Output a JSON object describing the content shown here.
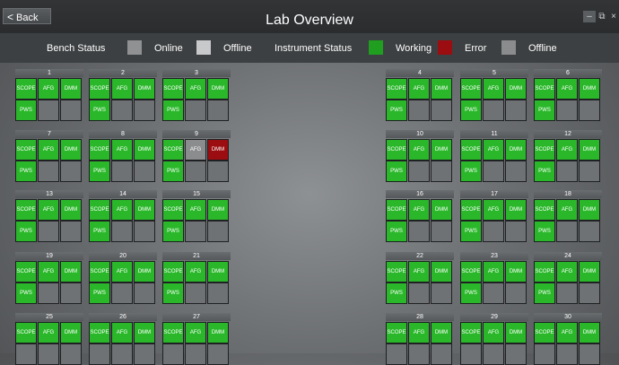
{
  "window": {
    "title": "Lab Overview",
    "back_label": "Back",
    "minimize": "–",
    "maximize": "⧉",
    "close": "×"
  },
  "legend": {
    "bench_status_label": "Bench Status",
    "online_label": "Online",
    "offline_label": "Offline",
    "instrument_status_label": "Instrument Status",
    "working_label": "Working",
    "error_label": "Error",
    "instrument_offline_label": "Offline",
    "colors": {
      "online": "#8f9193",
      "offline": "#c8c9ca",
      "working": "#1f9e1f",
      "error": "#9b0d10",
      "instrument_offline": "#8a8c8e"
    }
  },
  "benches": [
    {
      "number": "1",
      "instruments": [
        {
          "label": "SCOPE",
          "status": "working"
        },
        {
          "label": "AFG",
          "status": "working"
        },
        {
          "label": "DMM",
          "status": "working"
        },
        {
          "label": "PWS",
          "status": "working"
        },
        {
          "label": "",
          "status": "empty"
        },
        {
          "label": "",
          "status": "empty"
        }
      ]
    },
    {
      "number": "2",
      "instruments": [
        {
          "label": "SCOPE",
          "status": "working"
        },
        {
          "label": "AFG",
          "status": "working"
        },
        {
          "label": "DMM",
          "status": "working"
        },
        {
          "label": "PWS",
          "status": "working"
        },
        {
          "label": "",
          "status": "empty"
        },
        {
          "label": "",
          "status": "empty"
        }
      ]
    },
    {
      "number": "3",
      "instruments": [
        {
          "label": "SCOPE",
          "status": "working"
        },
        {
          "label": "AFG",
          "status": "working"
        },
        {
          "label": "DMM",
          "status": "working"
        },
        {
          "label": "PWS",
          "status": "working"
        },
        {
          "label": "",
          "status": "empty"
        },
        {
          "label": "",
          "status": "empty"
        }
      ]
    },
    {
      "number": "4",
      "instruments": [
        {
          "label": "SCOPE",
          "status": "working"
        },
        {
          "label": "AFG",
          "status": "working"
        },
        {
          "label": "DMM",
          "status": "working"
        },
        {
          "label": "PWS",
          "status": "working"
        },
        {
          "label": "",
          "status": "empty"
        },
        {
          "label": "",
          "status": "empty"
        }
      ]
    },
    {
      "number": "5",
      "instruments": [
        {
          "label": "SCOPE",
          "status": "working"
        },
        {
          "label": "AFG",
          "status": "working"
        },
        {
          "label": "DMM",
          "status": "working"
        },
        {
          "label": "PWS",
          "status": "working"
        },
        {
          "label": "",
          "status": "empty"
        },
        {
          "label": "",
          "status": "empty"
        }
      ]
    },
    {
      "number": "6",
      "instruments": [
        {
          "label": "SCOPE",
          "status": "working"
        },
        {
          "label": "AFG",
          "status": "working"
        },
        {
          "label": "DMM",
          "status": "working"
        },
        {
          "label": "PWS",
          "status": "working"
        },
        {
          "label": "",
          "status": "empty"
        },
        {
          "label": "",
          "status": "empty"
        }
      ]
    },
    {
      "number": "7",
      "instruments": [
        {
          "label": "SCOPE",
          "status": "working"
        },
        {
          "label": "AFG",
          "status": "working"
        },
        {
          "label": "DMM",
          "status": "working"
        },
        {
          "label": "PWS",
          "status": "working"
        },
        {
          "label": "",
          "status": "empty"
        },
        {
          "label": "",
          "status": "empty"
        }
      ]
    },
    {
      "number": "8",
      "instruments": [
        {
          "label": "SCOPE",
          "status": "working"
        },
        {
          "label": "AFG",
          "status": "working"
        },
        {
          "label": "DMM",
          "status": "working"
        },
        {
          "label": "PWS",
          "status": "working"
        },
        {
          "label": "",
          "status": "empty"
        },
        {
          "label": "",
          "status": "empty"
        }
      ]
    },
    {
      "number": "9",
      "instruments": [
        {
          "label": "SCOPE",
          "status": "working"
        },
        {
          "label": "AFG",
          "status": "offline"
        },
        {
          "label": "DMM",
          "status": "error"
        },
        {
          "label": "PWS",
          "status": "working"
        },
        {
          "label": "",
          "status": "empty"
        },
        {
          "label": "",
          "status": "empty"
        }
      ]
    },
    {
      "number": "10",
      "instruments": [
        {
          "label": "SCOPE",
          "status": "working"
        },
        {
          "label": "AFG",
          "status": "working"
        },
        {
          "label": "DMM",
          "status": "working"
        },
        {
          "label": "PWS",
          "status": "working"
        },
        {
          "label": "",
          "status": "empty"
        },
        {
          "label": "",
          "status": "empty"
        }
      ]
    },
    {
      "number": "11",
      "instruments": [
        {
          "label": "SCOPE",
          "status": "working"
        },
        {
          "label": "AFG",
          "status": "working"
        },
        {
          "label": "DMM",
          "status": "working"
        },
        {
          "label": "PWS",
          "status": "working"
        },
        {
          "label": "",
          "status": "empty"
        },
        {
          "label": "",
          "status": "empty"
        }
      ]
    },
    {
      "number": "12",
      "instruments": [
        {
          "label": "SCOPE",
          "status": "working"
        },
        {
          "label": "AFG",
          "status": "working"
        },
        {
          "label": "DMM",
          "status": "working"
        },
        {
          "label": "PWS",
          "status": "working"
        },
        {
          "label": "",
          "status": "empty"
        },
        {
          "label": "",
          "status": "empty"
        }
      ]
    },
    {
      "number": "13",
      "instruments": [
        {
          "label": "SCOPE",
          "status": "working"
        },
        {
          "label": "AFG",
          "status": "working"
        },
        {
          "label": "DMM",
          "status": "working"
        },
        {
          "label": "PWS",
          "status": "working"
        },
        {
          "label": "",
          "status": "empty"
        },
        {
          "label": "",
          "status": "empty"
        }
      ]
    },
    {
      "number": "14",
      "instruments": [
        {
          "label": "SCOPE",
          "status": "working"
        },
        {
          "label": "AFG",
          "status": "working"
        },
        {
          "label": "DMM",
          "status": "working"
        },
        {
          "label": "PWS",
          "status": "working"
        },
        {
          "label": "",
          "status": "empty"
        },
        {
          "label": "",
          "status": "empty"
        }
      ]
    },
    {
      "number": "15",
      "instruments": [
        {
          "label": "SCOPE",
          "status": "working"
        },
        {
          "label": "AFG",
          "status": "working"
        },
        {
          "label": "DMM",
          "status": "working"
        },
        {
          "label": "PWS",
          "status": "working"
        },
        {
          "label": "",
          "status": "empty"
        },
        {
          "label": "",
          "status": "empty"
        }
      ]
    },
    {
      "number": "16",
      "instruments": [
        {
          "label": "SCOPE",
          "status": "working"
        },
        {
          "label": "AFG",
          "status": "working"
        },
        {
          "label": "DMM",
          "status": "working"
        },
        {
          "label": "PWS",
          "status": "working"
        },
        {
          "label": "",
          "status": "empty"
        },
        {
          "label": "",
          "status": "empty"
        }
      ]
    },
    {
      "number": "17",
      "instruments": [
        {
          "label": "SCOPE",
          "status": "working"
        },
        {
          "label": "AFG",
          "status": "working"
        },
        {
          "label": "DMM",
          "status": "working"
        },
        {
          "label": "PWS",
          "status": "working"
        },
        {
          "label": "",
          "status": "empty"
        },
        {
          "label": "",
          "status": "empty"
        }
      ]
    },
    {
      "number": "18",
      "instruments": [
        {
          "label": "SCOPE",
          "status": "working"
        },
        {
          "label": "AFG",
          "status": "working"
        },
        {
          "label": "DMM",
          "status": "working"
        },
        {
          "label": "PWS",
          "status": "working"
        },
        {
          "label": "",
          "status": "empty"
        },
        {
          "label": "",
          "status": "empty"
        }
      ]
    },
    {
      "number": "19",
      "instruments": [
        {
          "label": "SCOPE",
          "status": "working"
        },
        {
          "label": "AFG",
          "status": "working"
        },
        {
          "label": "DMM",
          "status": "working"
        },
        {
          "label": "PWS",
          "status": "working"
        },
        {
          "label": "",
          "status": "empty"
        },
        {
          "label": "",
          "status": "empty"
        }
      ]
    },
    {
      "number": "20",
      "instruments": [
        {
          "label": "SCOPE",
          "status": "working"
        },
        {
          "label": "AFG",
          "status": "working"
        },
        {
          "label": "DMM",
          "status": "working"
        },
        {
          "label": "PWS",
          "status": "working"
        },
        {
          "label": "",
          "status": "empty"
        },
        {
          "label": "",
          "status": "empty"
        }
      ]
    },
    {
      "number": "21",
      "instruments": [
        {
          "label": "SCOPE",
          "status": "working"
        },
        {
          "label": "AFG",
          "status": "working"
        },
        {
          "label": "DMM",
          "status": "working"
        },
        {
          "label": "PWS",
          "status": "working"
        },
        {
          "label": "",
          "status": "empty"
        },
        {
          "label": "",
          "status": "empty"
        }
      ]
    },
    {
      "number": "22",
      "instruments": [
        {
          "label": "SCOPE",
          "status": "working"
        },
        {
          "label": "AFG",
          "status": "working"
        },
        {
          "label": "DMM",
          "status": "working"
        },
        {
          "label": "PWS",
          "status": "working"
        },
        {
          "label": "",
          "status": "empty"
        },
        {
          "label": "",
          "status": "empty"
        }
      ]
    },
    {
      "number": "23",
      "instruments": [
        {
          "label": "SCOPE",
          "status": "working"
        },
        {
          "label": "AFG",
          "status": "working"
        },
        {
          "label": "DMM",
          "status": "working"
        },
        {
          "label": "PWS",
          "status": "working"
        },
        {
          "label": "",
          "status": "empty"
        },
        {
          "label": "",
          "status": "empty"
        }
      ]
    },
    {
      "number": "24",
      "instruments": [
        {
          "label": "SCOPE",
          "status": "working"
        },
        {
          "label": "AFG",
          "status": "working"
        },
        {
          "label": "DMM",
          "status": "working"
        },
        {
          "label": "PWS",
          "status": "working"
        },
        {
          "label": "",
          "status": "empty"
        },
        {
          "label": "",
          "status": "empty"
        }
      ]
    },
    {
      "number": "25",
      "instruments": [
        {
          "label": "SCOPE",
          "status": "working"
        },
        {
          "label": "AFG",
          "status": "working"
        },
        {
          "label": "DMM",
          "status": "working"
        },
        {
          "label": "",
          "status": "empty"
        },
        {
          "label": "",
          "status": "empty"
        },
        {
          "label": "",
          "status": "empty"
        }
      ]
    },
    {
      "number": "26",
      "instruments": [
        {
          "label": "SCOPE",
          "status": "working"
        },
        {
          "label": "AFG",
          "status": "working"
        },
        {
          "label": "DMM",
          "status": "working"
        },
        {
          "label": "",
          "status": "empty"
        },
        {
          "label": "",
          "status": "empty"
        },
        {
          "label": "",
          "status": "empty"
        }
      ]
    },
    {
      "number": "27",
      "instruments": [
        {
          "label": "SCOPE",
          "status": "working"
        },
        {
          "label": "AFG",
          "status": "working"
        },
        {
          "label": "DMM",
          "status": "working"
        },
        {
          "label": "",
          "status": "empty"
        },
        {
          "label": "",
          "status": "empty"
        },
        {
          "label": "",
          "status": "empty"
        }
      ]
    },
    {
      "number": "28",
      "instruments": [
        {
          "label": "SCOPE",
          "status": "working"
        },
        {
          "label": "AFG",
          "status": "working"
        },
        {
          "label": "DMM",
          "status": "working"
        },
        {
          "label": "",
          "status": "empty"
        },
        {
          "label": "",
          "status": "empty"
        },
        {
          "label": "",
          "status": "empty"
        }
      ]
    },
    {
      "number": "29",
      "instruments": [
        {
          "label": "SCOPE",
          "status": "working"
        },
        {
          "label": "AFG",
          "status": "working"
        },
        {
          "label": "DMM",
          "status": "working"
        },
        {
          "label": "",
          "status": "empty"
        },
        {
          "label": "",
          "status": "empty"
        },
        {
          "label": "",
          "status": "empty"
        }
      ]
    },
    {
      "number": "30",
      "instruments": [
        {
          "label": "SCOPE",
          "status": "working"
        },
        {
          "label": "AFG",
          "status": "working"
        },
        {
          "label": "DMM",
          "status": "working"
        },
        {
          "label": "",
          "status": "empty"
        },
        {
          "label": "",
          "status": "empty"
        },
        {
          "label": "",
          "status": "empty"
        }
      ]
    }
  ]
}
